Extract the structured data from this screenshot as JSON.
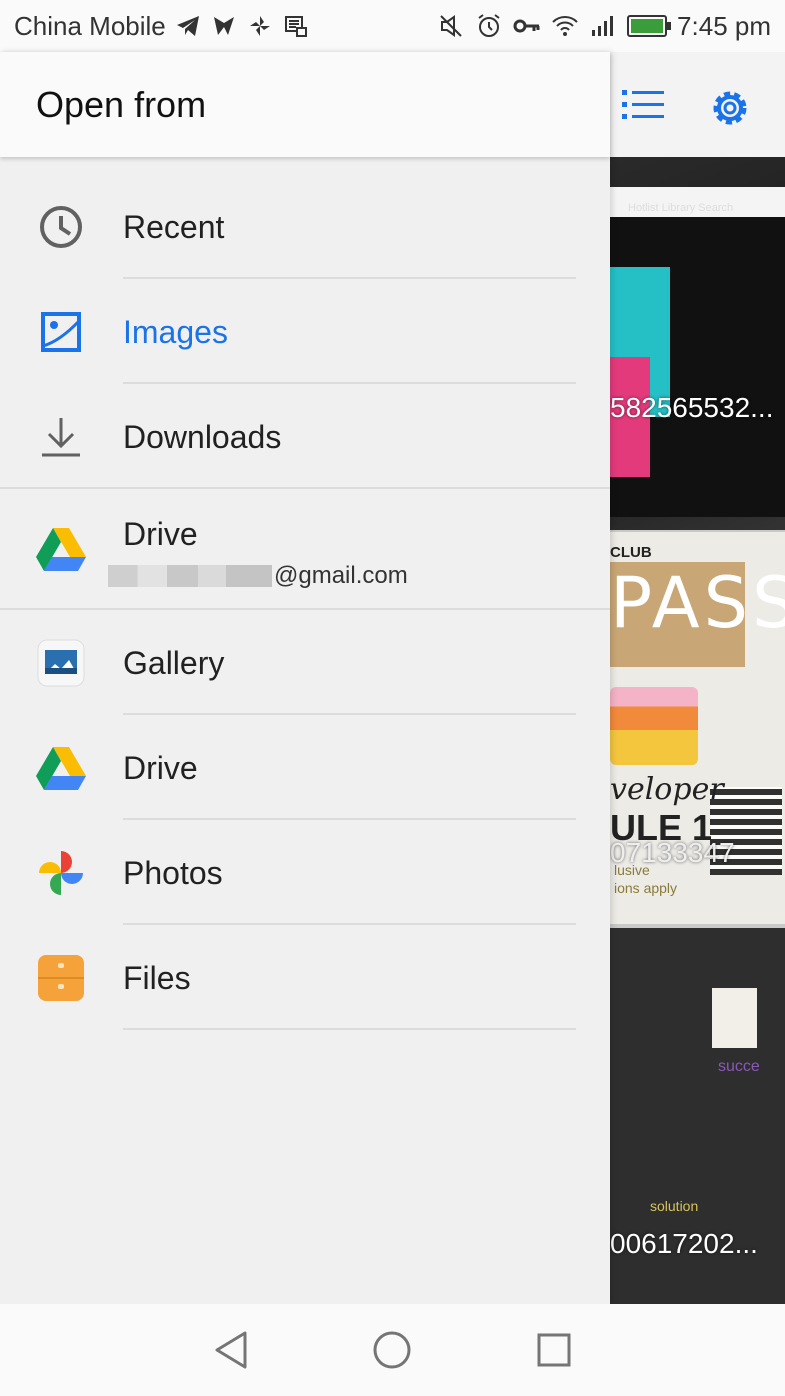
{
  "status_bar": {
    "carrier": "China Mobile",
    "time": "7:45 pm",
    "battery_level": 0.95
  },
  "drawer": {
    "title": "Open from",
    "items": [
      {
        "label": "Recent",
        "icon": "clock-icon",
        "active": false
      },
      {
        "label": "Images",
        "icon": "image-icon",
        "active": true
      },
      {
        "label": "Downloads",
        "icon": "download-icon",
        "active": false
      },
      {
        "label": "Drive",
        "icon": "google-drive-icon",
        "active": false,
        "account_suffix": "@gmail.com"
      },
      {
        "label": "Gallery",
        "icon": "gallery-icon",
        "active": false
      },
      {
        "label": "Drive",
        "icon": "google-drive-icon",
        "active": false
      },
      {
        "label": "Photos",
        "icon": "google-photos-icon",
        "active": false
      },
      {
        "label": "Files",
        "icon": "files-icon",
        "active": false
      }
    ],
    "accent_color": "#1a73e8"
  },
  "background_app": {
    "toolbar_icons": [
      "list-view-icon",
      "settings-icon"
    ],
    "tiles": [
      {
        "caption": "582565532...",
        "texts": {
          "hotlist": "Hotlist   Library   Search"
        }
      },
      {
        "caption": "07133347",
        "texts": {
          "club": "CLUB",
          "pass": "PASS",
          "dev": "veloper",
          "ule": "ULE 1",
          "excl": "lusive",
          "cond": "ions apply"
        }
      },
      {
        "caption": "00617202...",
        "texts": {
          "succ": "succe",
          "sol": "solution"
        }
      }
    ]
  },
  "nav_bar": {
    "buttons": [
      "back-icon",
      "home-icon",
      "recents-icon"
    ]
  }
}
